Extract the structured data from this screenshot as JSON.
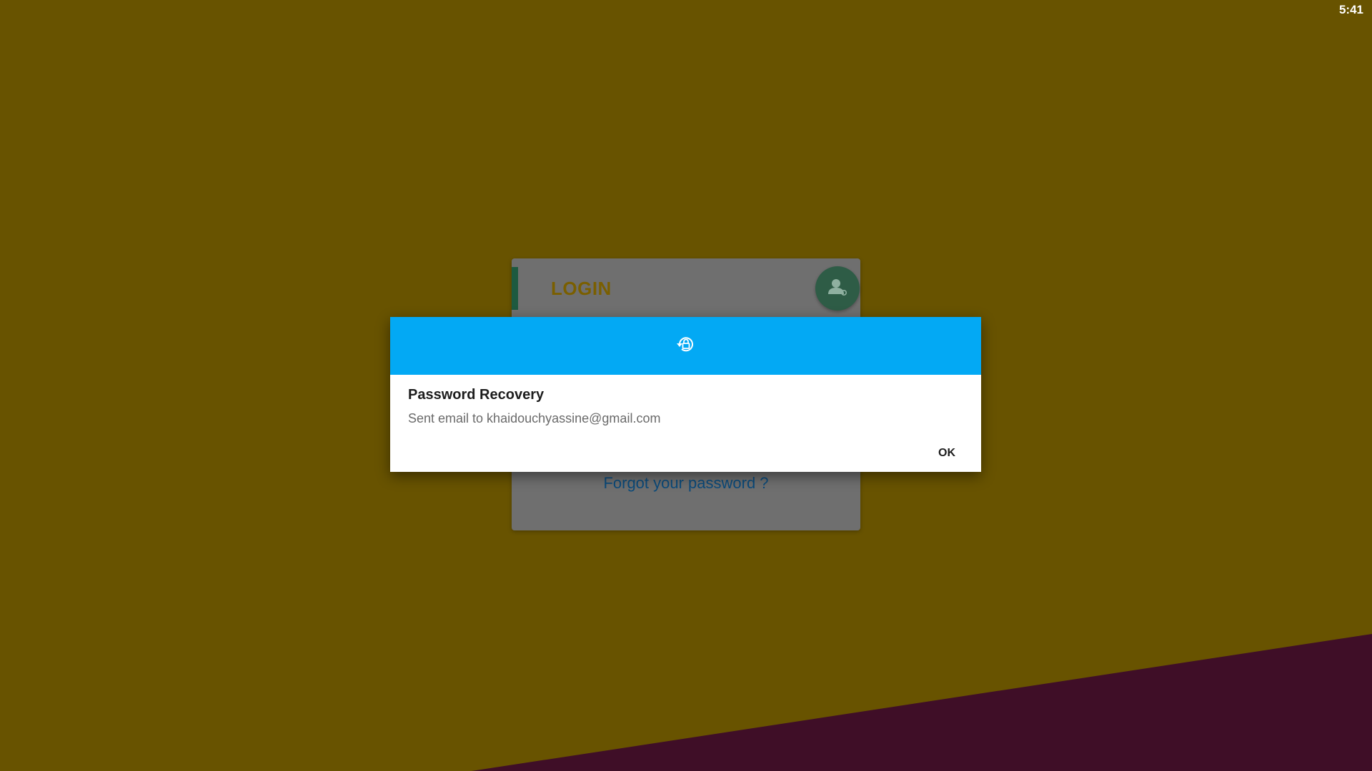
{
  "status_bar": {
    "time": "5:41"
  },
  "colors": {
    "background": "#685300",
    "stripe": "#3f0e27",
    "card": "#6f6f6f",
    "card_accent": "#1d5a40",
    "login_title": "#7a5f00",
    "avatar": "#2e5c46",
    "dialog_header": "#03a9f4",
    "link": "#0b4a7a"
  },
  "login_card": {
    "title": "LOGIN",
    "avatar_icon": "user-settings-icon",
    "forgot_password": "Forgot your password ?"
  },
  "dialog": {
    "header_icon": "lock-reset-icon",
    "title": "Password Recovery",
    "message": "Sent email to khaidouchyassine@gmail.com",
    "ok_label": "OK"
  }
}
